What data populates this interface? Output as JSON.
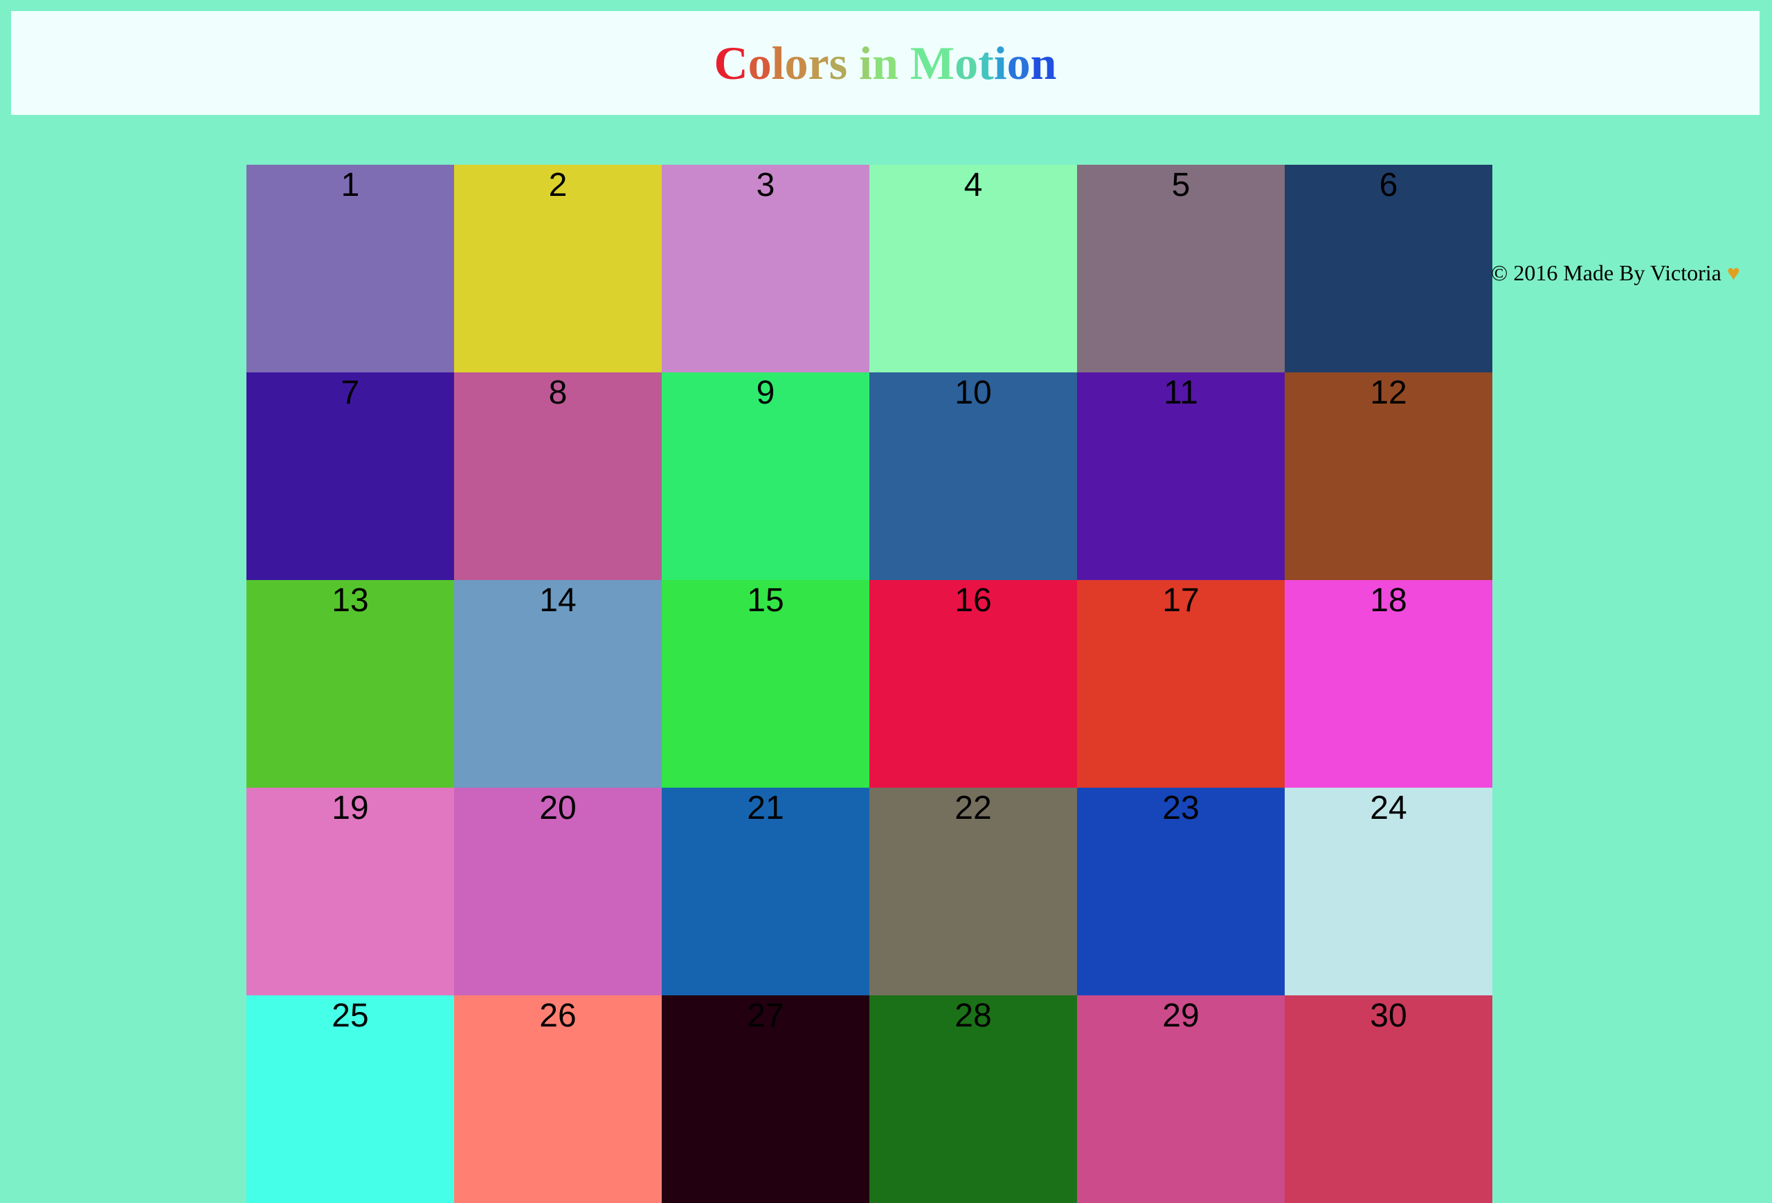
{
  "header": {
    "title_letters": [
      {
        "ch": "C",
        "color": "#e8202e"
      },
      {
        "ch": "o",
        "color": "#d85a3a"
      },
      {
        "ch": "l",
        "color": "#d07a42"
      },
      {
        "ch": "o",
        "color": "#c88c48"
      },
      {
        "ch": "r",
        "color": "#c09a50"
      },
      {
        "ch": "s",
        "color": "#b4a85a"
      },
      {
        "ch": " ",
        "color": "#a8b462"
      },
      {
        "ch": "i",
        "color": "#98d070"
      },
      {
        "ch": "n",
        "color": "#8ae07a"
      },
      {
        "ch": " ",
        "color": "#7ee884"
      },
      {
        "ch": "M",
        "color": "#6ee896"
      },
      {
        "ch": "o",
        "color": "#5cd6a8"
      },
      {
        "ch": "t",
        "color": "#44c4c0"
      },
      {
        "ch": "i",
        "color": "#2f9ed4"
      },
      {
        "ch": "o",
        "color": "#2874dc"
      },
      {
        "ch": "n",
        "color": "#2050e0"
      }
    ]
  },
  "cells": [
    {
      "label": "1",
      "color": "#7f6db4"
    },
    {
      "label": "2",
      "color": "#dbd22d"
    },
    {
      "label": "3",
      "color": "#c988cb"
    },
    {
      "label": "4",
      "color": "#8ef9b3"
    },
    {
      "label": "5",
      "color": "#826e7e"
    },
    {
      "label": "6",
      "color": "#203e6a"
    },
    {
      "label": "7",
      "color": "#3c179e"
    },
    {
      "label": "8",
      "color": "#be5995"
    },
    {
      "label": "9",
      "color": "#2eeb6d"
    },
    {
      "label": "10",
      "color": "#2c6199"
    },
    {
      "label": "11",
      "color": "#5516a7"
    },
    {
      "label": "12",
      "color": "#934a24"
    },
    {
      "label": "13",
      "color": "#56c52d"
    },
    {
      "label": "14",
      "color": "#6d9bc2"
    },
    {
      "label": "15",
      "color": "#33e546"
    },
    {
      "label": "16",
      "color": "#e91245"
    },
    {
      "label": "17",
      "color": "#e03a29"
    },
    {
      "label": "18",
      "color": "#f049dc"
    },
    {
      "label": "19",
      "color": "#e077c0"
    },
    {
      "label": "20",
      "color": "#cc63bd"
    },
    {
      "label": "21",
      "color": "#1664b0"
    },
    {
      "label": "22",
      "color": "#75705e"
    },
    {
      "label": "23",
      "color": "#1746bb"
    },
    {
      "label": "24",
      "color": "#c0e6ea"
    },
    {
      "label": "25",
      "color": "#45ffe8"
    },
    {
      "label": "26",
      "color": "#ff8073"
    },
    {
      "label": "27",
      "color": "#22000f"
    },
    {
      "label": "28",
      "color": "#1b7117"
    },
    {
      "label": "29",
      "color": "#cc4b8a"
    },
    {
      "label": "30",
      "color": "#cc3a5c"
    }
  ],
  "footer": {
    "text": "© 2016 Made By Victoria",
    "heart": "♥",
    "heart_color": "#e0a020"
  }
}
